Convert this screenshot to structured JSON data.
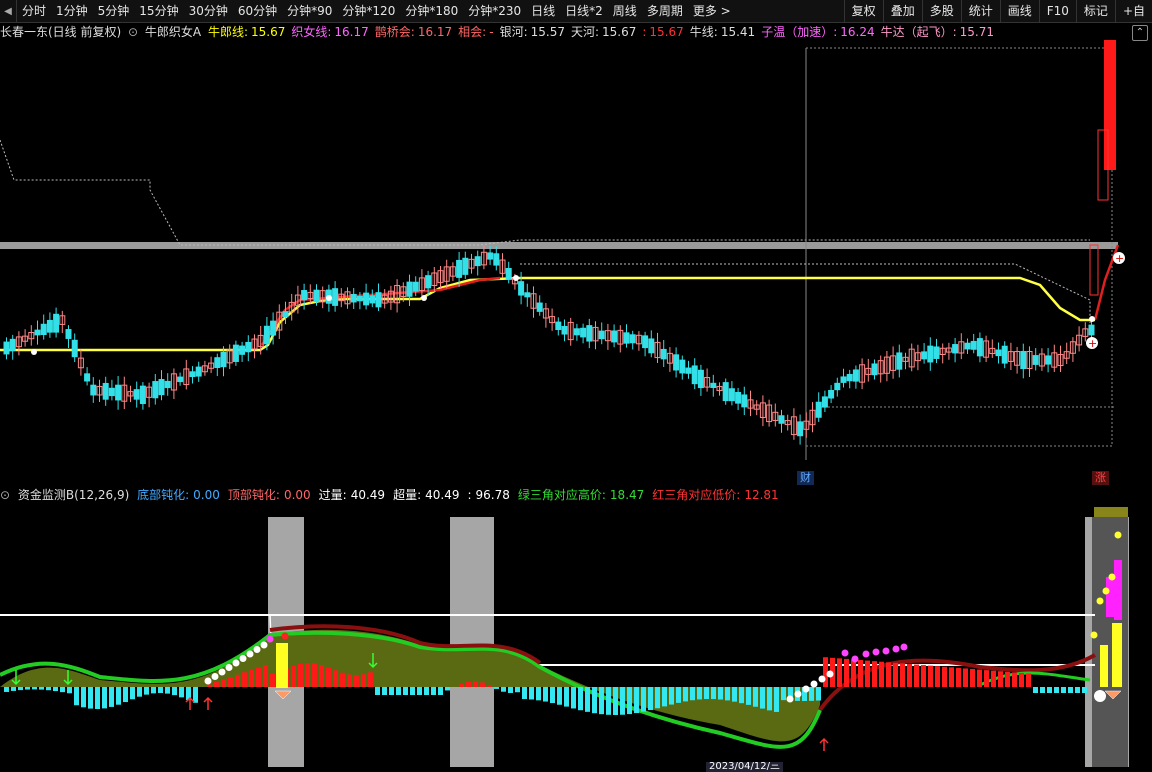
{
  "toolbar": {
    "left_arrow": "◀",
    "items": [
      "分时",
      "1分钟",
      "5分钟",
      "15分钟",
      "30分钟",
      "60分钟",
      "分钟*90",
      "分钟*120",
      "分钟*180",
      "分钟*230",
      "日线",
      "日线*2",
      "周线",
      "多周期",
      "更多 >"
    ],
    "right_items": [
      "复权",
      "叠加",
      "多股",
      "统计",
      "画线",
      "F10",
      "标记",
      "+自"
    ]
  },
  "main_header": {
    "stock": "长春一东(日线 前复权)",
    "indicator": "牛郎织女A",
    "fields": [
      {
        "label": "牛郎线:",
        "value": "15.67",
        "color": "#ffff00"
      },
      {
        "label": "织女线:",
        "value": "16.17",
        "color": "#ff66ff"
      },
      {
        "label": "鹊桥会:",
        "value": "16.17",
        "color": "#ff6666"
      },
      {
        "label": "相会:",
        "value": "-",
        "color": "#ff6666"
      },
      {
        "label": "银河:",
        "value": "15.57",
        "color": "#dddddd"
      },
      {
        "label": "天河:",
        "value": "15.67",
        "color": "#dddddd"
      },
      {
        "label": ":",
        "value": "15.67",
        "color": "#ff3333"
      },
      {
        "label": "牛线:",
        "value": "15.41",
        "color": "#dddddd"
      },
      {
        "label": "子温（加速）:",
        "value": "16.24",
        "color": "#ff66ff"
      },
      {
        "label": "牛达（起飞）:",
        "value": "15.71",
        "color": "#ff99cc"
      }
    ]
  },
  "side_button": "⌃",
  "markers": {
    "cai": "财",
    "zhang": "涨"
  },
  "sub_header": {
    "indicator": "资金监测B(12,26,9)",
    "fields": [
      {
        "label": "底部钝化:",
        "value": "0.00",
        "color": "#44aaff"
      },
      {
        "label": "顶部钝化:",
        "value": "0.00",
        "color": "#ff6666"
      },
      {
        "label": "过量:",
        "value": "40.49",
        "color": "#ffffff"
      },
      {
        "label": "超量:",
        "value": "40.49",
        "color": "#ffffff"
      },
      {
        "label": ":",
        "value": "96.78",
        "color": "#ffffff"
      },
      {
        "label": "绿三角对应高价:",
        "value": "18.47",
        "color": "#33dd33"
      },
      {
        "label": "红三角对应低价:",
        "value": "12.81",
        "color": "#ff3333"
      }
    ]
  },
  "date_chip": "2023/04/12/三",
  "colors": {
    "up": "#ff8888",
    "down": "#33e0e8",
    "yellow": "#ffff44",
    "red": "#ff2020",
    "gray": "#a0a0a0",
    "green": "#22bb22"
  }
}
